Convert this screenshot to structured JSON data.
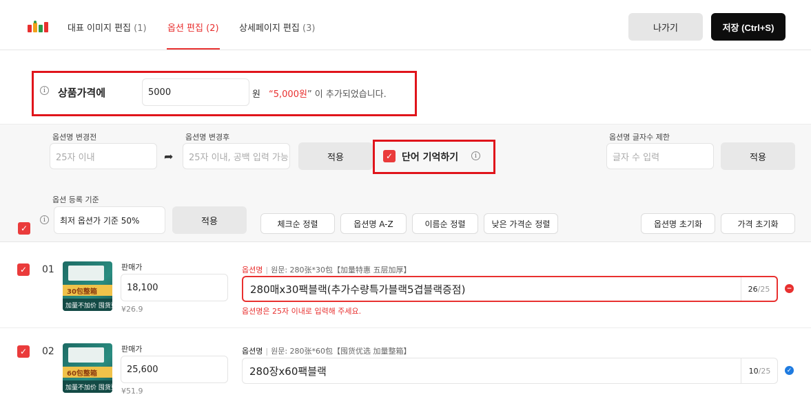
{
  "header": {
    "tabs": [
      {
        "label": "대표 이미지 편집",
        "count": "(1)"
      },
      {
        "label": "옵션 편집",
        "count": "(2)"
      },
      {
        "label": "상세페이지 편집",
        "count": "(3)"
      }
    ],
    "exit_label": "나가기",
    "save_label": "저장 (Ctrl+S)"
  },
  "price": {
    "label": "상품가격에",
    "value": "5000",
    "unit": "원",
    "notice_prefix": "“",
    "notice_amount": "5,000원",
    "notice_suffix": "” 이 추가되었습니다."
  },
  "tools": {
    "before_label": "옵션명 변경전",
    "before_placeholder": "25자 이내",
    "after_label": "옵션명 변경후",
    "after_placeholder": "25자 이내, 공백 입력 가능",
    "apply_label": "적용",
    "memo_label": "단어 기억하기",
    "limit_label": "옵션명 글자수 제한",
    "limit_placeholder": "글자 수 입력",
    "limit_apply_label": "적용",
    "basis_label": "옵션 등록 기준",
    "basis_value": "최저 옵션가 기준 50%",
    "basis_apply_label": "적용",
    "sort_buttons": [
      "체크순 정렬",
      "옵션명 A-Z",
      "이름순 정렬",
      "낮은 가격순 정렬"
    ],
    "reset_name_label": "옵션명 초기화",
    "reset_price_label": "가격 초기화"
  },
  "rows": [
    {
      "num": "01",
      "checked": true,
      "thumb_band": "30包整箱",
      "thumb_bottom": "加量不加价 囤货更划算",
      "sale_label": "판매가",
      "price": "18,100",
      "yuan": "¥26.9",
      "opt_label": "옵션명",
      "orig": "원문: 280张*30包【加量特惠 五层加厚】",
      "opt_value": "280매x30팩블랙(추가수량특가블랙5겹블랙증점)",
      "count": "26",
      "max": "/25",
      "error": "옵션명은 25자 이내로 입력해 주세요.",
      "status": "error",
      "status_color": "#e8302f"
    },
    {
      "num": "02",
      "checked": true,
      "thumb_band": "60包整箱",
      "thumb_bottom": "加量不加价 囤货更划算",
      "sale_label": "판매가",
      "price": "25,600",
      "yuan": "¥51.9",
      "opt_label": "옵션명",
      "orig": "원문: 280张*60包【囤货优选 加量整箱】",
      "opt_value": "280장x60팩블랙",
      "count": "10",
      "max": "/25",
      "error": "",
      "status": "ok",
      "status_color": "#1f7be0"
    }
  ],
  "colors": {
    "accent": "#e8302f",
    "checkbox": "#ea3b3b",
    "highlight_box": "#e0141b"
  }
}
